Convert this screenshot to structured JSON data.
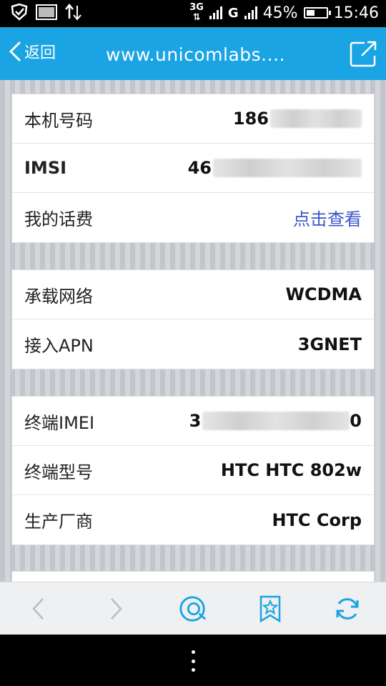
{
  "status_bar": {
    "network_type": "3G",
    "network_g": "G",
    "battery": "45%",
    "time": "15:46",
    "battery_level": 0.45
  },
  "header": {
    "back_label": "返回",
    "url": "www.unicomlabs....",
    "background": "#1aa4e3"
  },
  "cards": [
    {
      "rows": [
        {
          "label": "本机号码",
          "value": "186"
        },
        {
          "label": "IMSI",
          "value": "46"
        },
        {
          "label": "我的话费",
          "value": "点击查看"
        }
      ]
    },
    {
      "rows": [
        {
          "label": "承载网络",
          "value": "WCDMA"
        },
        {
          "label": "接入APN",
          "value": "3GNET"
        }
      ]
    },
    {
      "rows": [
        {
          "label": "终端IMEI",
          "value_prefix": "3",
          "value_suffix": "0"
        },
        {
          "label": "终端型号",
          "value": "HTC HTC 802w"
        },
        {
          "label": "生产厂商",
          "value": "HTC Corp"
        }
      ]
    }
  ],
  "toolbar": {
    "icons": [
      "back-arrow-icon",
      "forward-arrow-icon",
      "home-icon",
      "bookmark-star-icon",
      "refresh-icon"
    ]
  },
  "navbar": {
    "icons": [
      "menu-dots-icon"
    ]
  }
}
